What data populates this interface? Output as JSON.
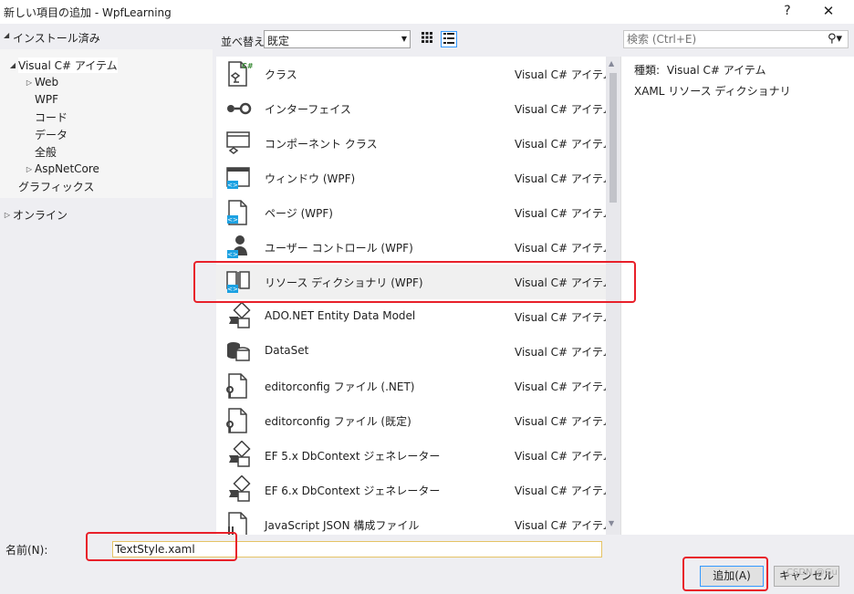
{
  "window": {
    "title": "新しい項目の追加 - WpfLearning",
    "help_label": "?",
    "close_label": "✕"
  },
  "sidebar": {
    "installed_label": "インストール済み",
    "tree": [
      {
        "label": "Visual C# アイテム",
        "level": 1,
        "expanded": true,
        "selected": true
      },
      {
        "label": "Web",
        "level": 2,
        "expandable": true
      },
      {
        "label": "WPF",
        "level": 2
      },
      {
        "label": "コード",
        "level": 2
      },
      {
        "label": "データ",
        "level": 2
      },
      {
        "label": "全般",
        "level": 2
      },
      {
        "label": "AspNetCore",
        "level": 2,
        "expandable": true
      },
      {
        "label": "グラフィックス",
        "level": 1
      }
    ],
    "online_label": "オンライン"
  },
  "toolbar": {
    "sort_label": "並べ替え:",
    "sort_value": "既定",
    "search_placeholder": "検索 (Ctrl+E)"
  },
  "items": [
    {
      "name": "クラス",
      "type": "Visual C# アイテム",
      "icon": "class-icon"
    },
    {
      "name": "インターフェイス",
      "type": "Visual C# アイテム",
      "icon": "interface-icon"
    },
    {
      "name": "コンポーネント クラス",
      "type": "Visual C# アイテム",
      "icon": "component-class-icon"
    },
    {
      "name": "ウィンドウ (WPF)",
      "type": "Visual C# アイテム",
      "icon": "window-icon"
    },
    {
      "name": "ページ (WPF)",
      "type": "Visual C# アイテム",
      "icon": "page-icon"
    },
    {
      "name": "ユーザー コントロール (WPF)",
      "type": "Visual C# アイテム",
      "icon": "user-control-icon"
    },
    {
      "name": "リソース ディクショナリ (WPF)",
      "type": "Visual C# アイテム",
      "icon": "resource-dictionary-icon",
      "selected": true
    },
    {
      "name": "ADO.NET Entity Data Model",
      "type": "Visual C# アイテム",
      "icon": "entity-model-icon"
    },
    {
      "name": "DataSet",
      "type": "Visual C# アイテム",
      "icon": "dataset-icon"
    },
    {
      "name": "editorconfig ファイル (.NET)",
      "type": "Visual C# アイテム",
      "icon": "editorconfig-icon"
    },
    {
      "name": "editorconfig ファイル (既定)",
      "type": "Visual C# アイテム",
      "icon": "editorconfig-icon"
    },
    {
      "name": "EF 5.x DbContext ジェネレーター",
      "type": "Visual C# アイテム",
      "icon": "dbcontext-generator-icon"
    },
    {
      "name": "EF 6.x DbContext ジェネレーター",
      "type": "Visual C# アイテム",
      "icon": "dbcontext-generator-icon"
    },
    {
      "name": "JavaScript JSON 構成ファイル",
      "type": "Visual C# アイテム",
      "icon": "json-config-icon"
    }
  ],
  "details": {
    "kind_label": "種類:",
    "kind_value": "Visual C# アイテム",
    "description": "XAML リソース ディクショナリ"
  },
  "bottom": {
    "name_label": "名前(N):",
    "name_value": "TextStyle.xaml",
    "add_label": "追加(A)",
    "cancel_label": "キャンセル"
  },
  "watermark": "CSDN @Gu",
  "colors": {
    "accent": "#3399ff",
    "annotation_red": "#e8202a",
    "panel_bg": "#eeeef2"
  }
}
